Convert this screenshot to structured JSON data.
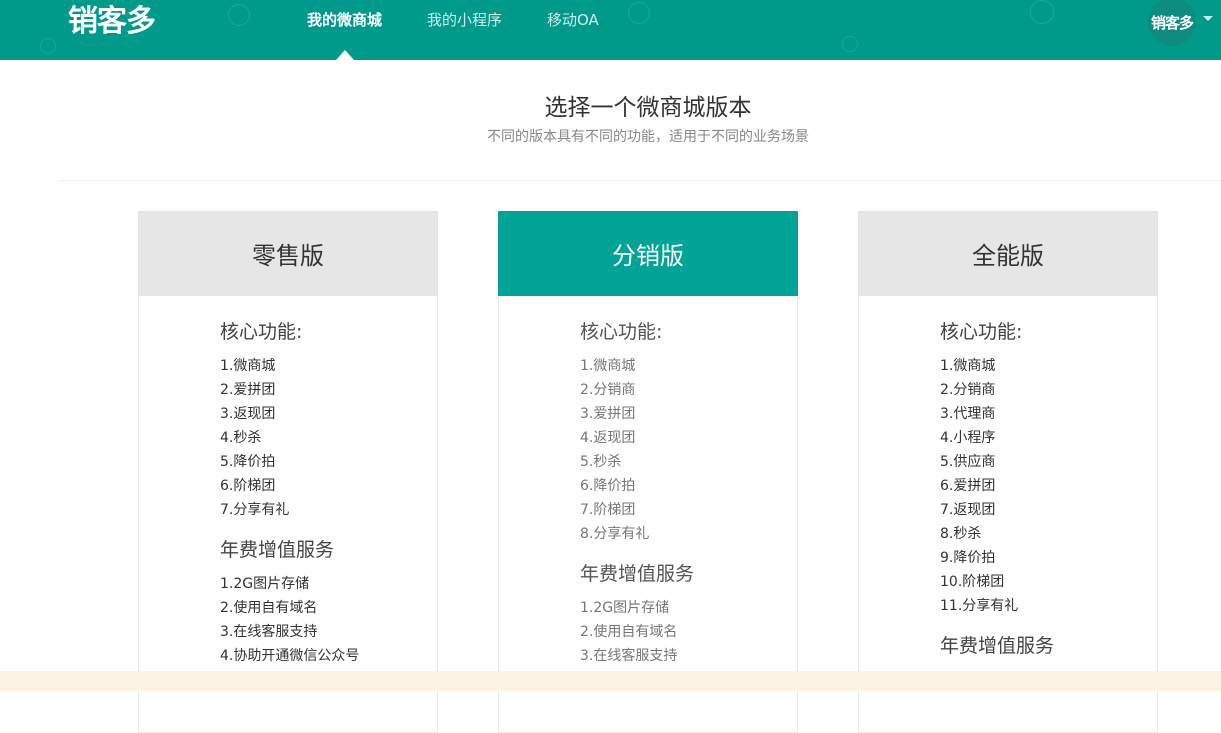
{
  "header": {
    "logo": "销客多",
    "nav": [
      {
        "label": "我的微商城",
        "active": true
      },
      {
        "label": "我的小程序",
        "active": false
      },
      {
        "label": "移动OA",
        "active": false
      }
    ],
    "avatar_text": "销客多"
  },
  "page": {
    "title": "选择一个微商城版本",
    "subtitle": "不同的版本具有不同的功能，适用于不同的业务场景"
  },
  "plans": [
    {
      "name": "零售版",
      "core_title": "核心功能:",
      "core_features": [
        "1.微商城",
        "2.爱拼团",
        "3.返现团",
        "4.秒杀",
        "5.降价拍",
        "6.阶梯团",
        "7.分享有礼"
      ],
      "service_title": "年费增值服务",
      "services": [
        "1.2G图片存储",
        "2.使用自有域名",
        "3.在线客服支持",
        "4.协助开通微信公众号"
      ]
    },
    {
      "name": "分销版",
      "core_title": "核心功能:",
      "core_features": [
        "1.微商城",
        "2.分销商",
        "3.爱拼团",
        "4.返现团",
        "5.秒杀",
        "6.降价拍",
        "7.阶梯团",
        "8.分享有礼"
      ],
      "service_title": "年费增值服务",
      "services": [
        "1.2G图片存储",
        "2.使用自有域名",
        "3.在线客服支持"
      ]
    },
    {
      "name": "全能版",
      "core_title": "核心功能:",
      "core_features": [
        "1.微商城",
        "2.分销商",
        "3.代理商",
        "4.小程序",
        "5.供应商",
        "6.爱拼团",
        "7.返现团",
        "8.秒杀",
        "9.降价拍",
        "10.阶梯团",
        "11.分享有礼"
      ],
      "service_title": "年费增值服务",
      "services": []
    }
  ],
  "colors": {
    "brand": "#009a8a",
    "featured_header": "#00a396",
    "card_header": "#e6e6e6"
  }
}
